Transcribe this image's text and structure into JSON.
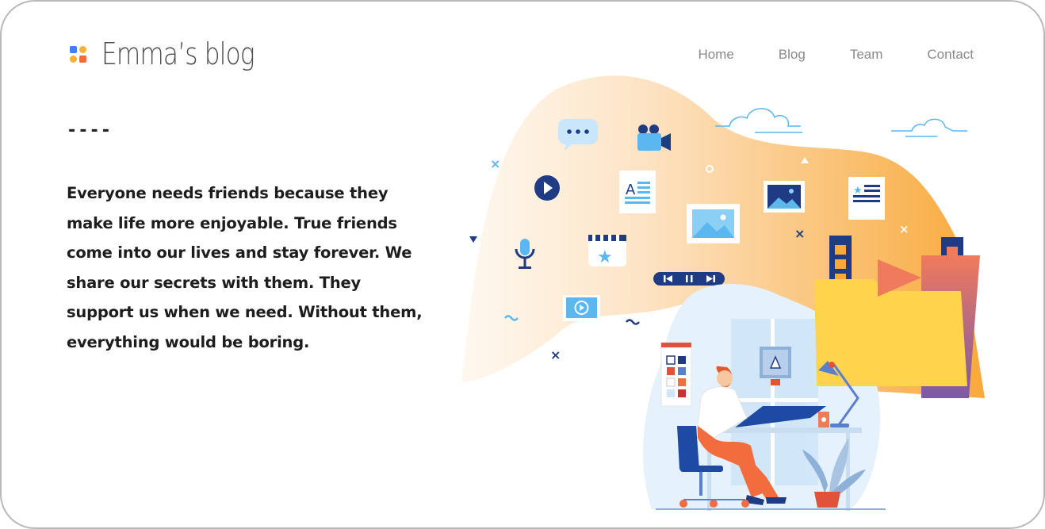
{
  "header": {
    "logo_text": "Emma’s blog",
    "nav": [
      "Home",
      "Blog",
      "Team",
      "Contact"
    ]
  },
  "main": {
    "divider": "----",
    "paragraph": "Everyone needs friends because they make life more enjoyable. True friends come into our lives and stay forever. We share our secrets with them. They support us when we need. Without them, everything would be boring."
  },
  "colors": {
    "logo_blue": "#3f7ef6",
    "logo_yellow": "#f7b136",
    "logo_orange": "#f26c3d",
    "navy": "#1e3b83",
    "sky": "#5ab7f0"
  },
  "illustration": {
    "icons": [
      "chat-bubble-icon",
      "video-camera-icon",
      "play-button-icon",
      "document-icon",
      "image-icon",
      "news-icon",
      "microphone-icon",
      "clapperboard-icon",
      "media-controls-icon",
      "video-frame-icon",
      "folder-icon",
      "film-strip-icon",
      "cloud-icon",
      "desk-lamp-icon",
      "plant-icon",
      "color-palette-icon"
    ]
  }
}
